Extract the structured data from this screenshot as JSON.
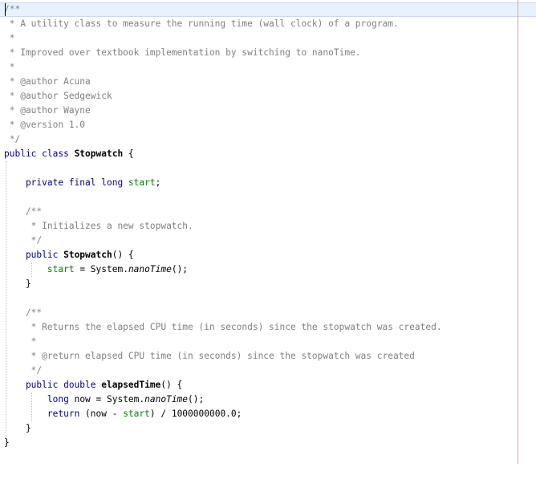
{
  "lines": [
    {
      "parts": [
        {
          "t": "/**",
          "c": "cm"
        }
      ]
    },
    {
      "parts": [
        {
          "t": " * A utility class to measure the running time (wall clock) of a program.",
          "c": "cm"
        }
      ]
    },
    {
      "parts": [
        {
          "t": " *",
          "c": "cm"
        }
      ]
    },
    {
      "parts": [
        {
          "t": " * Improved over textbook implementation by switching to nanoTime.",
          "c": "cm"
        }
      ]
    },
    {
      "parts": [
        {
          "t": " *",
          "c": "cm"
        }
      ]
    },
    {
      "parts": [
        {
          "t": " * @author Acuna",
          "c": "cm"
        }
      ]
    },
    {
      "parts": [
        {
          "t": " * @author Sedgewick",
          "c": "cm"
        }
      ]
    },
    {
      "parts": [
        {
          "t": " * @author Wayne",
          "c": "cm"
        }
      ]
    },
    {
      "parts": [
        {
          "t": " * @version 1.0",
          "c": "cm"
        }
      ]
    },
    {
      "parts": [
        {
          "t": " */",
          "c": "cm"
        }
      ]
    },
    {
      "parts": [
        {
          "t": "public class ",
          "c": "kw"
        },
        {
          "t": "Stopwatch",
          "c": "plain bold"
        },
        {
          "t": " {",
          "c": "plain"
        }
      ]
    },
    {
      "parts": []
    },
    {
      "parts": [
        {
          "t": "    private final long ",
          "c": "kw"
        },
        {
          "t": "start",
          "c": "fd"
        },
        {
          "t": ";",
          "c": "plain"
        }
      ]
    },
    {
      "parts": []
    },
    {
      "parts": [
        {
          "t": "    /**",
          "c": "cm"
        }
      ]
    },
    {
      "parts": [
        {
          "t": "     * Initializes a new stopwatch.",
          "c": "cm"
        }
      ]
    },
    {
      "parts": [
        {
          "t": "     */",
          "c": "cm"
        }
      ]
    },
    {
      "parts": [
        {
          "t": "    public ",
          "c": "kw"
        },
        {
          "t": "Stopwatch",
          "c": "plain bold"
        },
        {
          "t": "() {",
          "c": "plain"
        }
      ]
    },
    {
      "parts": [
        {
          "t": "        ",
          "c": "plain"
        },
        {
          "t": "start",
          "c": "fd"
        },
        {
          "t": " = System.",
          "c": "plain"
        },
        {
          "t": "nanoTime",
          "c": "plain it"
        },
        {
          "t": "();",
          "c": "plain"
        }
      ]
    },
    {
      "parts": [
        {
          "t": "    }",
          "c": "plain"
        }
      ]
    },
    {
      "parts": []
    },
    {
      "parts": [
        {
          "t": "    /**",
          "c": "cm"
        }
      ]
    },
    {
      "parts": [
        {
          "t": "     * Returns the elapsed CPU time (in seconds) since the stopwatch was created.",
          "c": "cm"
        }
      ]
    },
    {
      "parts": [
        {
          "t": "     *",
          "c": "cm"
        }
      ]
    },
    {
      "parts": [
        {
          "t": "     * @return elapsed CPU time (in seconds) since the stopwatch was created",
          "c": "cm"
        }
      ]
    },
    {
      "parts": [
        {
          "t": "     */",
          "c": "cm"
        }
      ]
    },
    {
      "parts": [
        {
          "t": "    public double ",
          "c": "kw"
        },
        {
          "t": "elapsedTime",
          "c": "plain bold"
        },
        {
          "t": "() {",
          "c": "plain"
        }
      ]
    },
    {
      "parts": [
        {
          "t": "        ",
          "c": "plain"
        },
        {
          "t": "long ",
          "c": "kw"
        },
        {
          "t": "now = System.",
          "c": "plain"
        },
        {
          "t": "nanoTime",
          "c": "plain it"
        },
        {
          "t": "();",
          "c": "plain"
        }
      ]
    },
    {
      "parts": [
        {
          "t": "        ",
          "c": "plain"
        },
        {
          "t": "return ",
          "c": "kw"
        },
        {
          "t": "(now - ",
          "c": "plain"
        },
        {
          "t": "start",
          "c": "fd"
        },
        {
          "t": ") / 1000000000.0;",
          "c": "plain"
        }
      ]
    },
    {
      "parts": [
        {
          "t": "    }",
          "c": "plain"
        }
      ]
    },
    {
      "parts": [
        {
          "t": "}",
          "c": "plain"
        }
      ]
    }
  ],
  "colors": {
    "comment": "#808080",
    "keyword": "#000080",
    "field": "#008000",
    "current_line": "#e8f2fe",
    "print_margin": "#e8a0a0"
  }
}
